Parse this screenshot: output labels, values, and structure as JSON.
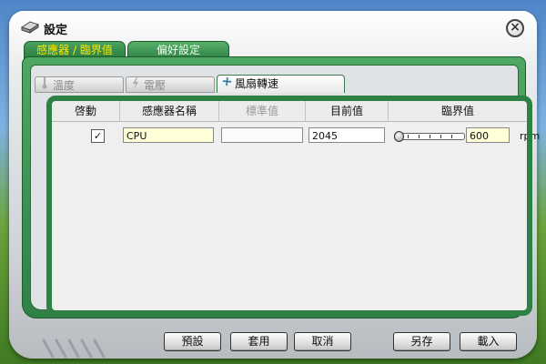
{
  "window": {
    "title": "設定"
  },
  "outer_tabs": [
    {
      "label": "感應器 / 臨界值",
      "active": true
    },
    {
      "label": "偏好設定",
      "active": false
    }
  ],
  "inner_tabs": [
    {
      "label": "溫度",
      "icon": "thermometer-icon",
      "active": false
    },
    {
      "label": "電壓",
      "icon": "lightning-icon",
      "active": false
    },
    {
      "label": "風扇轉速",
      "icon": "fan-icon",
      "active": true
    }
  ],
  "table": {
    "headers": {
      "enable": "啓動",
      "name": "感應器名稱",
      "standard": "標準值",
      "current": "目前值",
      "threshold": "臨界值"
    },
    "rows": [
      {
        "enabled": true,
        "check_mark": "✓",
        "name": "CPU",
        "standard": "",
        "current": "2045",
        "threshold": "600",
        "unit": "rpm",
        "slider_level": 0.0
      }
    ]
  },
  "buttons": {
    "default": "預設",
    "apply": "套用",
    "cancel": "取消",
    "save_as": "另存",
    "load": "載入"
  },
  "colors": {
    "panel_green": "#2f8045",
    "active_tab_text": "#ffe800",
    "field_highlight": "#ffffd8"
  }
}
